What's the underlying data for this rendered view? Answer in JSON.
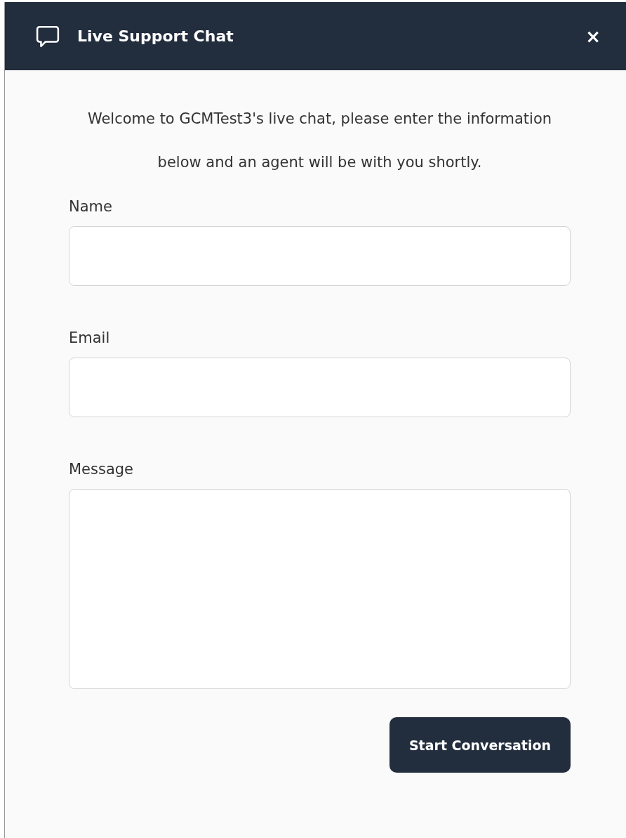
{
  "header": {
    "title": "Live Support Chat",
    "close": "×"
  },
  "intro": "Welcome to GCMTest3's live chat, please enter the information below and an agent will be with you shortly.",
  "fields": [
    {
      "label": "Name",
      "kind": "input"
    },
    {
      "label": "Email",
      "kind": "input"
    },
    {
      "label": "Message",
      "kind": "textarea"
    }
  ],
  "submit": "Start Conversation"
}
